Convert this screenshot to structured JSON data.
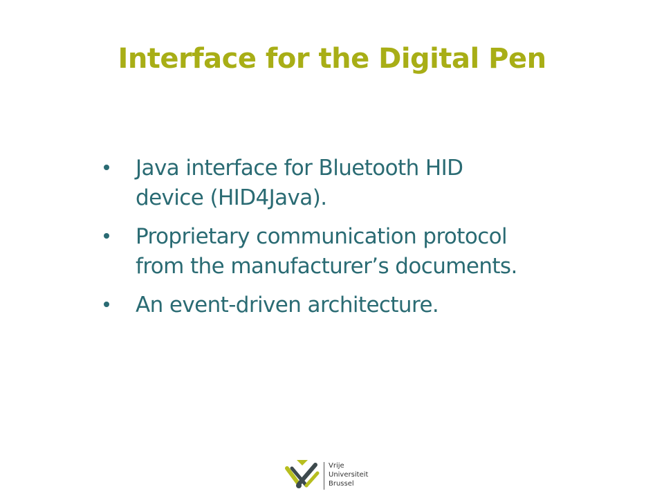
{
  "slide": {
    "title": "Interface for the Digital Pen",
    "bullets": [
      {
        "line1": "Java interface for Bluetooth HID",
        "line2": "device (HID4Java)."
      },
      {
        "line1": "Proprietary communication protocol",
        "line2": "from the manufacturer’s documents."
      },
      {
        "line1": "An event-driven architecture.",
        "line2": ""
      }
    ]
  },
  "logo": {
    "lines": [
      "Vrije",
      "Universiteit",
      "Brussel"
    ]
  },
  "colors": {
    "title": "#a8ae16",
    "body": "#2a6b73",
    "logo_accent": "#b7be1f",
    "logo_dark": "#3d4a4d"
  }
}
